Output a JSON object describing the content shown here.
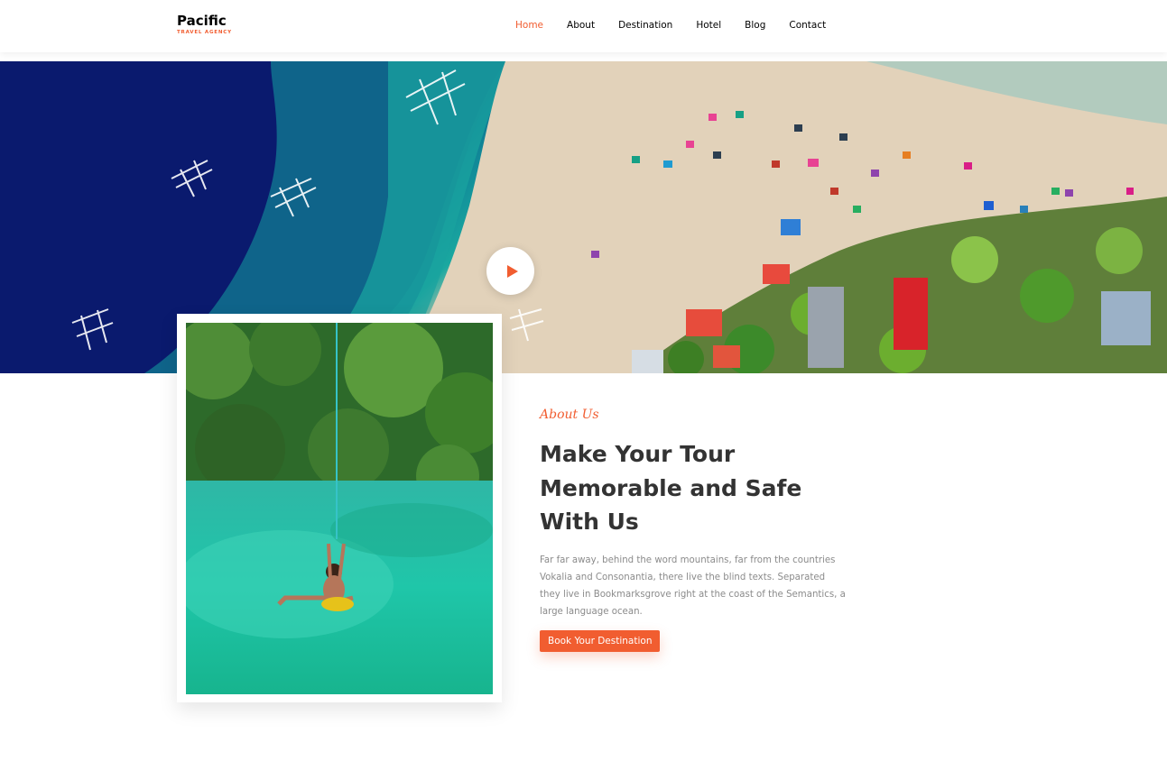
{
  "brand": {
    "name": "Pacific",
    "tagline": "TRAVEL AGENCY"
  },
  "nav": {
    "items": [
      {
        "label": "Home",
        "active": true
      },
      {
        "label": "About",
        "active": false
      },
      {
        "label": "Destination",
        "active": false
      },
      {
        "label": "Hotel",
        "active": false
      },
      {
        "label": "Blog",
        "active": false
      },
      {
        "label": "Contact",
        "active": false
      }
    ]
  },
  "hero": {
    "play_icon": "play-icon"
  },
  "about": {
    "subheading": "About Us",
    "headline": "Make Your Tour Memorable and Safe With Us",
    "paragraph": "Far far away, behind the word mountains, far from the countries Vokalia and Consonantia, there live the blind texts. Separated they live in Bookmarksgrove right at the coast of the Semantics, a large language ocean.",
    "cta_label": "Book Your Destination"
  },
  "colors": {
    "accent": "#f15d30",
    "heading": "#333333",
    "body_text": "#8b8b8b"
  }
}
